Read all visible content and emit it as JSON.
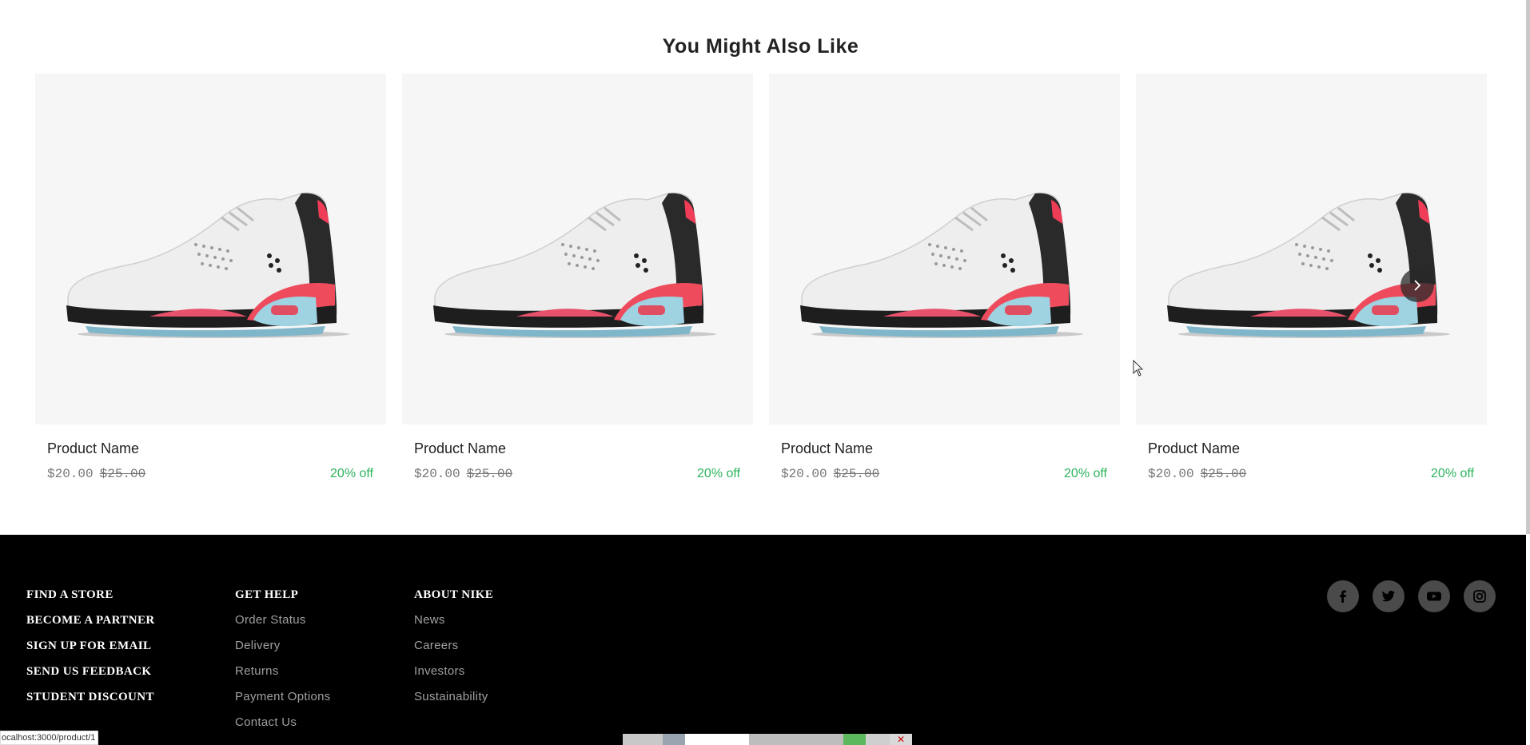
{
  "section": {
    "title": "You Might Also Like"
  },
  "products": [
    {
      "name": "Product Name",
      "price": "$20.00",
      "old_price": "$25.00",
      "discount": "20% off"
    },
    {
      "name": "Product Name",
      "price": "$20.00",
      "old_price": "$25.00",
      "discount": "20% off"
    },
    {
      "name": "Product Name",
      "price": "$20.00",
      "old_price": "$25.00",
      "discount": "20% off"
    },
    {
      "name": "Product Name",
      "price": "$20.00",
      "old_price": "$25.00",
      "discount": "20% off"
    }
  ],
  "carousel": {
    "next_icon": "chevron-right-icon"
  },
  "footer": {
    "primary_links": [
      "FIND A STORE",
      "BECOME A PARTNER",
      "SIGN UP FOR EMAIL",
      "SEND US FEEDBACK",
      "STUDENT DISCOUNT"
    ],
    "get_help": {
      "heading": "GET HELP",
      "links": [
        "Order Status",
        "Delivery",
        "Returns",
        "Payment Options",
        "Contact Us"
      ]
    },
    "about": {
      "heading": "ABOUT NIKE",
      "links": [
        "News",
        "Careers",
        "Investors",
        "Sustainability"
      ]
    },
    "socials": [
      "facebook-icon",
      "twitter-icon",
      "youtube-icon",
      "instagram-icon"
    ]
  },
  "status_bar": {
    "url": "ocalhost:3000/product/1"
  },
  "colors": {
    "discount": "#2db35d",
    "footer_bg": "#000000",
    "card_bg": "#f6f6f6"
  }
}
